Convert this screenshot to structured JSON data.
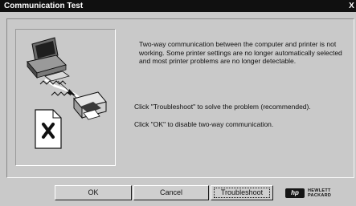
{
  "window": {
    "title": "Communication Test",
    "close_glyph": "X"
  },
  "message": {
    "main": "Two-way communication between the computer and printer is not working. Some printer settings are no longer automatically selected and most printer problems are no longer detectable.",
    "troubleshoot_hint": "Click \"Troubleshoot\" to solve the problem (recommended).",
    "ok_hint": "Click \"OK\" to disable two-way communication."
  },
  "illustration": {
    "icons": [
      "computer-icon",
      "communication-lines-icon",
      "printer-icon",
      "document-error-icon"
    ],
    "error_mark": "x-mark"
  },
  "buttons": {
    "ok": "OK",
    "cancel": "Cancel",
    "troubleshoot": "Troubleshoot"
  },
  "brand": {
    "badge": "hp",
    "line1": "HEWLETT",
    "line2": "PACKARD"
  }
}
